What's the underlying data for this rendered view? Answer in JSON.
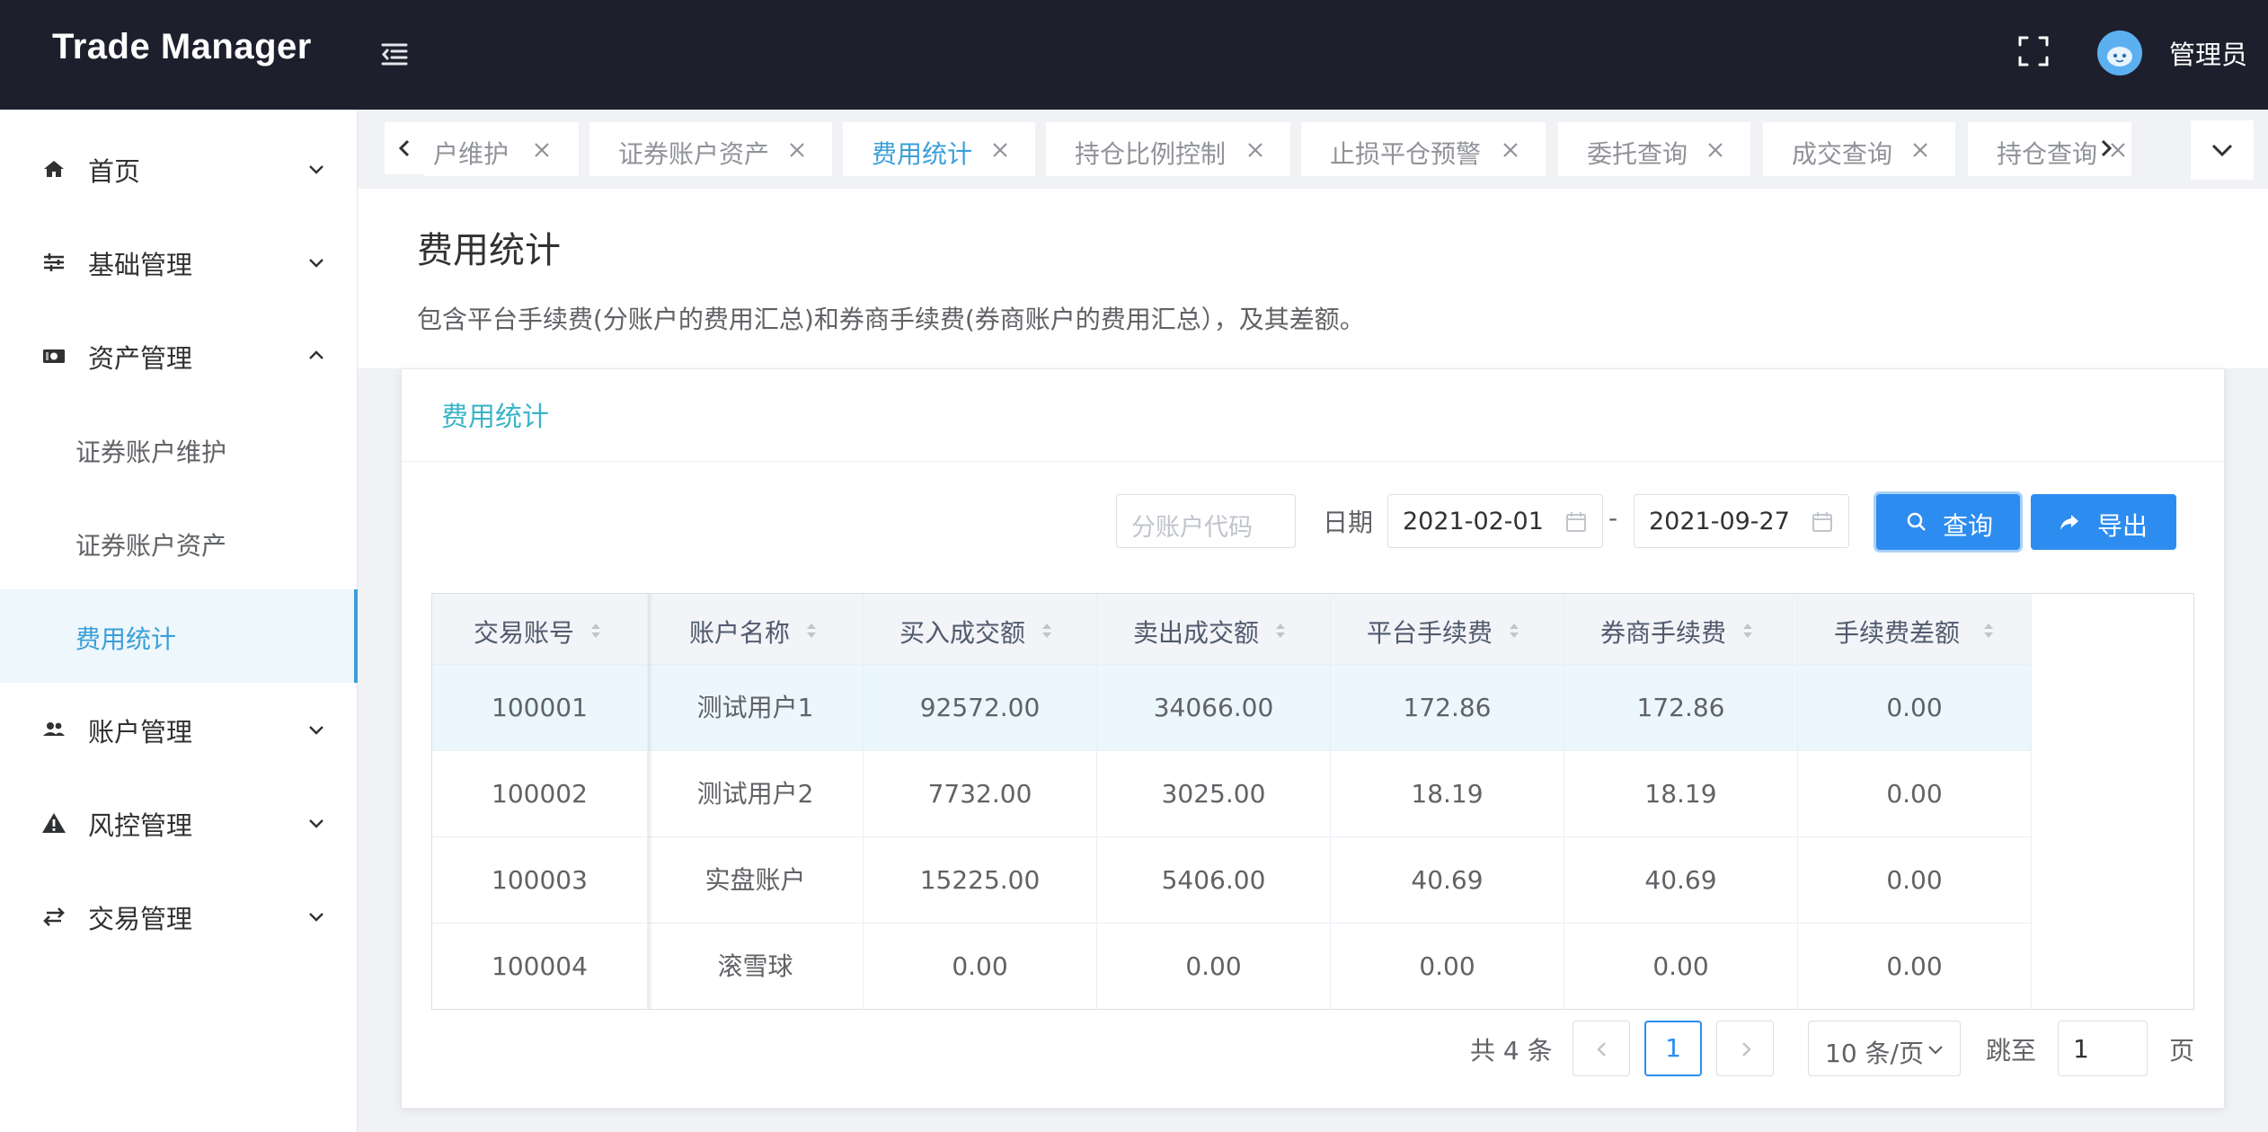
{
  "header": {
    "brand": "Trade Manager",
    "user_name": "管理员",
    "icons": {
      "menu": "menu-fold-icon",
      "fullscreen": "fullscreen-icon",
      "avatar": "avatar"
    }
  },
  "sidebar": {
    "items": [
      {
        "label": "首页",
        "icon": "home-icon",
        "expanded": false
      },
      {
        "label": "基础管理",
        "icon": "sliders-icon",
        "expanded": false
      },
      {
        "label": "资产管理",
        "icon": "money-icon",
        "expanded": true,
        "children": [
          {
            "label": "证券账户维护",
            "active": false
          },
          {
            "label": "证券账户资产",
            "active": false
          },
          {
            "label": "费用统计",
            "active": true
          }
        ]
      },
      {
        "label": "账户管理",
        "icon": "users-icon",
        "expanded": false
      },
      {
        "label": "风控管理",
        "icon": "warning-icon",
        "expanded": false
      },
      {
        "label": "交易管理",
        "icon": "swap-icon",
        "expanded": false
      }
    ]
  },
  "tabs": [
    {
      "label": "户维护",
      "active": false
    },
    {
      "label": "证券账户资产",
      "active": false
    },
    {
      "label": "费用统计",
      "active": true
    },
    {
      "label": "持仓比例控制",
      "active": false
    },
    {
      "label": "止损平仓预警",
      "active": false
    },
    {
      "label": "委托查询",
      "active": false
    },
    {
      "label": "成交查询",
      "active": false
    },
    {
      "label": "持仓查询",
      "active": false
    }
  ],
  "page": {
    "title": "费用统计",
    "description": "包含平台手续费(分账户的费用汇总)和券商手续费(券商账户的费用汇总），及其差额。"
  },
  "card": {
    "title": "费用统计",
    "filters": {
      "account_placeholder": "分账户代码",
      "date_label": "日期",
      "date_from": "2021-02-01",
      "date_sep": "-",
      "date_to": "2021-09-27",
      "query_label": "查询",
      "export_label": "导出"
    }
  },
  "table": {
    "columns": [
      "交易账号",
      "账户名称",
      "买入成交额",
      "卖出成交额",
      "平台手续费",
      "券商手续费",
      "手续费差额"
    ],
    "rows": [
      [
        "100001",
        "测试用户1",
        "92572.00",
        "34066.00",
        "172.86",
        "172.86",
        "0.00"
      ],
      [
        "100002",
        "测试用户2",
        "7732.00",
        "3025.00",
        "18.19",
        "18.19",
        "0.00"
      ],
      [
        "100003",
        "实盘账户",
        "15225.00",
        "5406.00",
        "40.69",
        "40.69",
        "0.00"
      ],
      [
        "100004",
        "滚雪球",
        "0.00",
        "0.00",
        "0.00",
        "0.00",
        "0.00"
      ]
    ]
  },
  "pagination": {
    "total_text": "共 4 条",
    "current_page": "1",
    "page_size": "10 条/页",
    "jump_label": "跳至",
    "jump_value": "1",
    "page_suffix": "页"
  },
  "colors": {
    "header_bg": "#1e1f2c",
    "accent": "#3a9fd8",
    "primary_button": "#2d8cf0",
    "card_title": "#3ab4c8",
    "row_highlight": "#ebf7fd"
  }
}
